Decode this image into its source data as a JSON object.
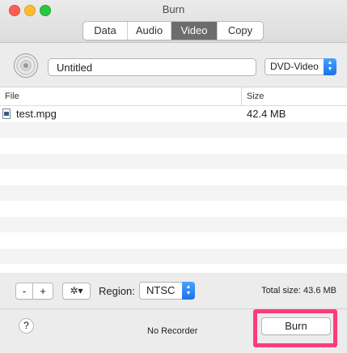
{
  "window": {
    "title": "Burn",
    "tabs": [
      {
        "label": "Data",
        "active": false
      },
      {
        "label": "Audio",
        "active": false
      },
      {
        "label": "Video",
        "active": true
      },
      {
        "label": "Copy",
        "active": false
      }
    ]
  },
  "disc": {
    "name_value": "Untitled",
    "format_selected": "DVD-Video"
  },
  "table": {
    "columns": [
      "File",
      "Size"
    ],
    "rows": [
      {
        "file": "test.mpg",
        "size": "42.4 MB"
      }
    ]
  },
  "toolbar": {
    "minus_label": "-",
    "plus_label": "+",
    "gear_label": "✲▾",
    "region_label": "Region:",
    "region_selected": "NTSC",
    "total_size": "Total size: 43.6 MB"
  },
  "status": {
    "help_label": "?",
    "recorder": "No Recorder",
    "burn_label": "Burn"
  },
  "colors": {
    "highlight": "#ff3a7a",
    "active_tab": "#6c6c6c",
    "select_accent": "#1a73e8"
  }
}
